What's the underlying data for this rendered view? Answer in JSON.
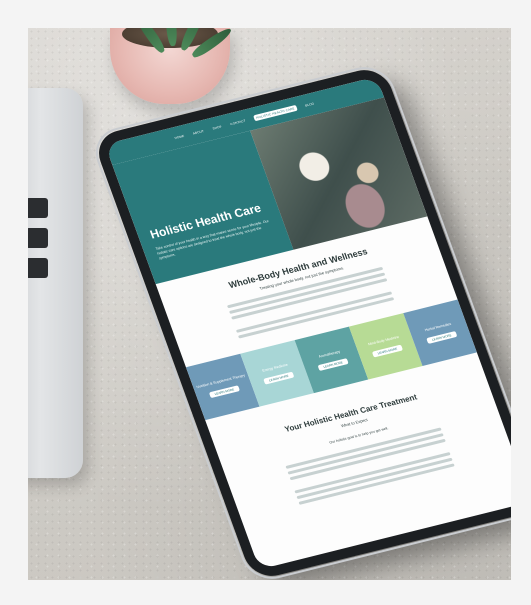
{
  "nav": {
    "items": [
      "HOME",
      "ABOUT",
      "SHOP",
      "CONTACT",
      "HOLISTIC HEALTH CARE",
      "BLOG"
    ],
    "active_index": 4
  },
  "hero": {
    "title": "Holistic Health Care",
    "text": "Take control of your health in a way that makes sense for your lifestyle. Our holistic care options are designed to treat the whole body, not just the symptoms."
  },
  "section1": {
    "title": "Whole-Body Health and Wellness",
    "subtitle": "Treating your whole body, not just the symptoms."
  },
  "tiles": [
    {
      "label": "Nutrition & Supplement Therapy",
      "button": "LEARN MORE",
      "color": "#6f9ab8"
    },
    {
      "label": "Energy Medicine",
      "button": "LEARN MORE",
      "color": "#a8d6d6"
    },
    {
      "label": "Aromatherapy",
      "button": "LEARN MORE",
      "color": "#5ea3a3"
    },
    {
      "label": "Mind-Body Medicine",
      "button": "LEARN MORE",
      "color": "#b7db95"
    },
    {
      "label": "Herbal Remedies",
      "button": "LEARN MORE",
      "color": "#6f9ab8"
    }
  ],
  "section2": {
    "title": "Your Holistic Health Care Treatment",
    "subtitle": "What to Expect",
    "line": "Our holistic goal is to help you get well."
  },
  "colors": {
    "brand_teal": "#2a7a7c",
    "background": "#f4f4f4"
  }
}
